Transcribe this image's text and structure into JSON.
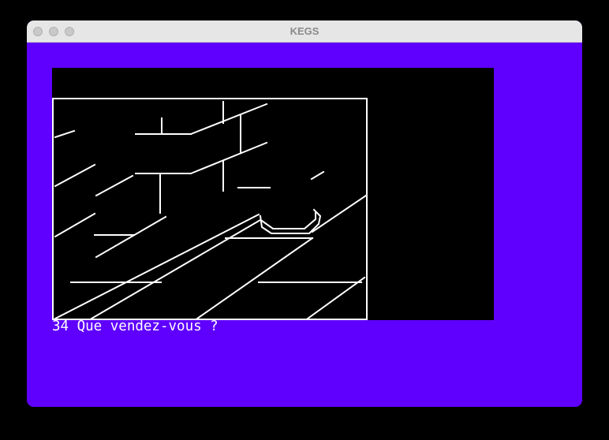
{
  "window": {
    "title": "KEGS",
    "background_color": "#5f00ff",
    "titlebar_color": "#e6e6e6",
    "traffic_light_color": "#c9c9c9"
  },
  "screen": {
    "prompt_text": "34 Que vendez-vous ?",
    "text_color": "#ffffff"
  },
  "scene": {
    "description_icon": "line-art-room-icon"
  }
}
